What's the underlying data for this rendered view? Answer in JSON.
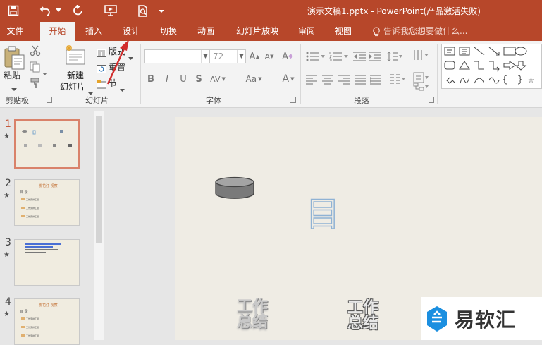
{
  "window": {
    "title": "演示文稿1.pptx - PowerPoint(产品激活失败)"
  },
  "quick_access": [
    "save-icon",
    "undo-icon",
    "redo-icon",
    "start-from-beginning-icon",
    "print-preview-icon"
  ],
  "tabs": [
    {
      "label": "文件"
    },
    {
      "label": "开始"
    },
    {
      "label": "插入"
    },
    {
      "label": "设计"
    },
    {
      "label": "切换"
    },
    {
      "label": "动画"
    },
    {
      "label": "幻灯片放映"
    },
    {
      "label": "审阅"
    },
    {
      "label": "视图"
    }
  ],
  "active_tab": "开始",
  "tell_me": {
    "placeholder": "告诉我您想要做什么..."
  },
  "ribbon": {
    "clipboard": {
      "paste": "粘贴",
      "group": "剪贴板"
    },
    "slides": {
      "new_slide_line1": "新建",
      "new_slide_line2": "幻灯片",
      "layout": "版式",
      "reset": "重置",
      "section": "节",
      "group": "幻灯片"
    },
    "font": {
      "font_name": "",
      "font_size": "72",
      "bold": "B",
      "italic": "I",
      "underline": "U",
      "shadow": "S",
      "spacing": "AV",
      "case": "Aa",
      "grow": "A",
      "shrink": "A",
      "clear": "A",
      "color": "A",
      "group": "字体"
    },
    "paragraph": {
      "group": "段落"
    }
  },
  "slides": [
    {
      "number": "1",
      "selected": true
    },
    {
      "number": "2",
      "title": "桃花汀·视察",
      "label": "目 录",
      "items": [
        "工作安排汇报",
        "工作安排汇报",
        "工作安排汇报"
      ]
    },
    {
      "number": "3"
    },
    {
      "number": "4",
      "title": "桃花汀·视察",
      "label": "目 录",
      "items": [
        "工作安排汇报",
        "工作安排汇报",
        "工作安排汇报"
      ]
    }
  ],
  "main_slide": {
    "outline_char": "目",
    "text_a": "工作总结",
    "text_b": "工作总结"
  },
  "watermark": {
    "text": "易软汇"
  },
  "colors": {
    "accent": "#b7472a",
    "selected_thumb_border": "#d9826a",
    "slide_bg": "#efece4"
  }
}
